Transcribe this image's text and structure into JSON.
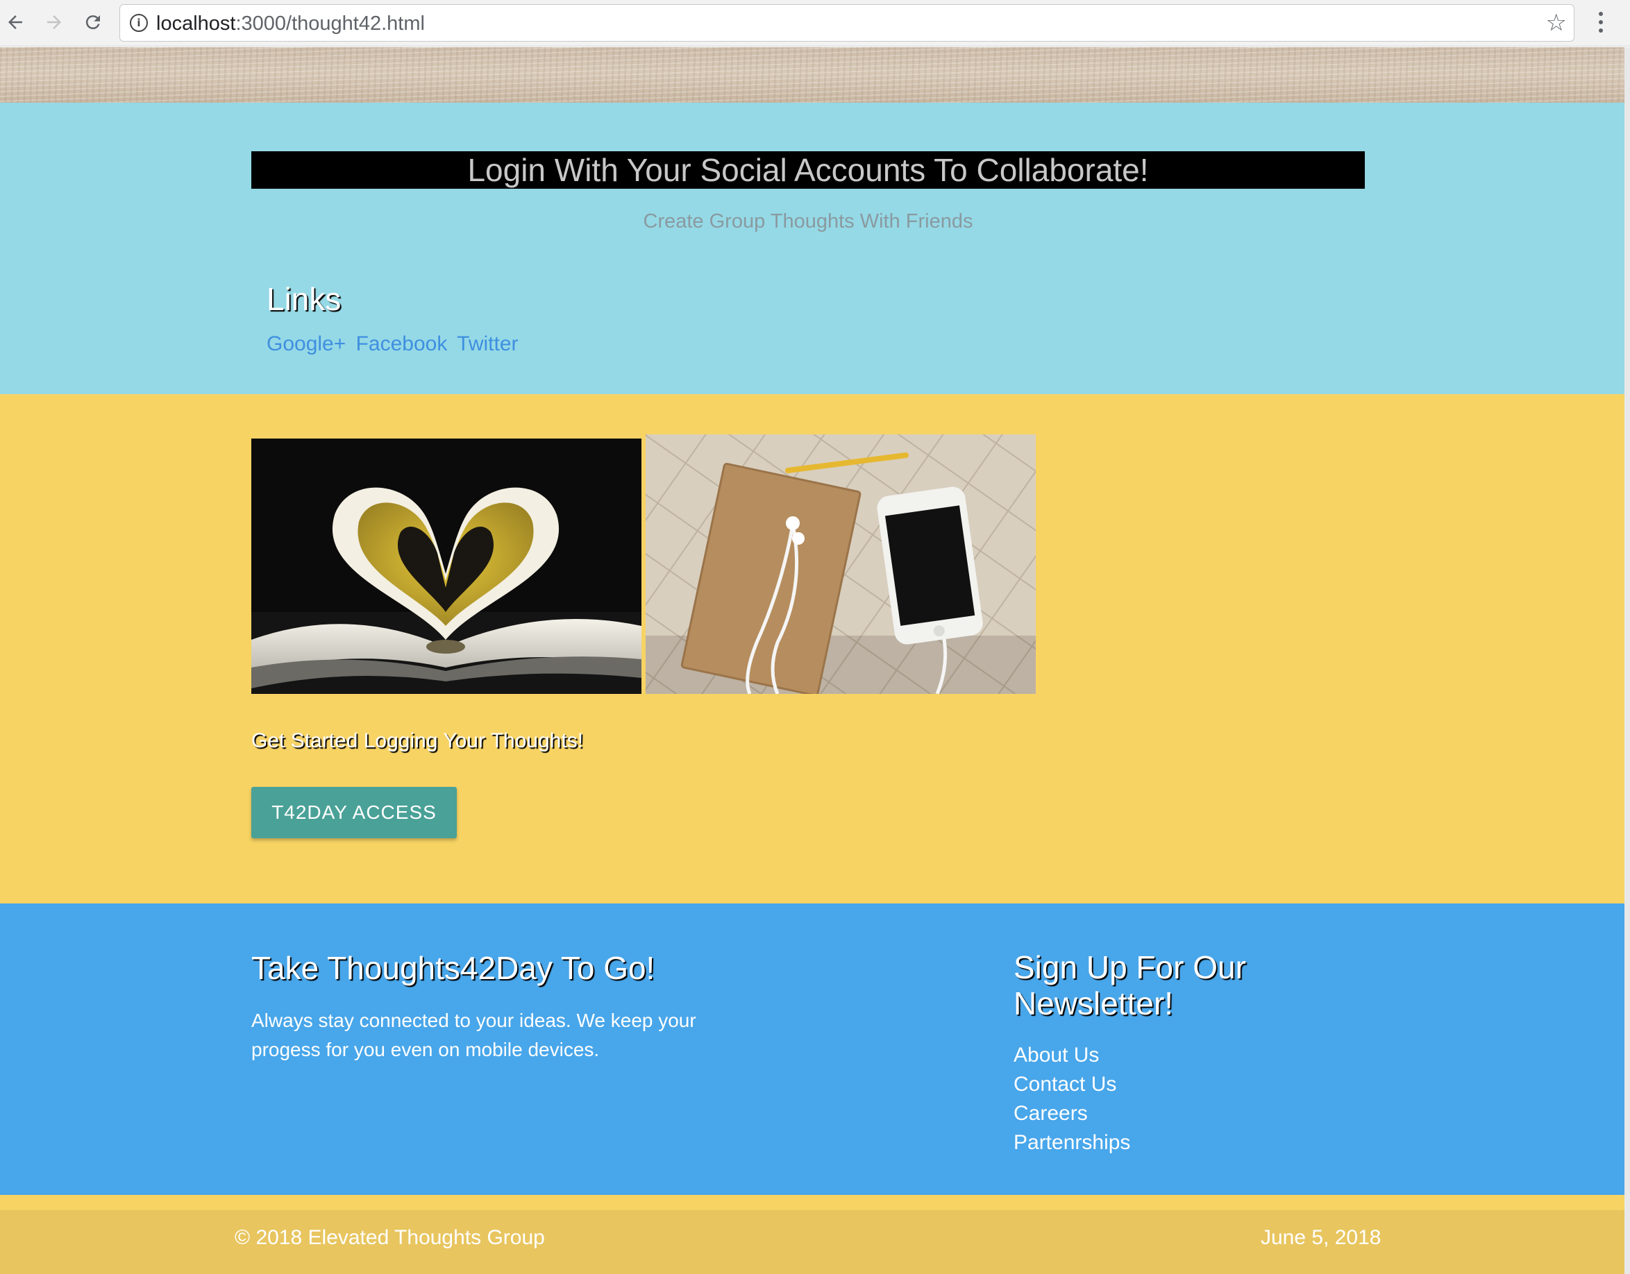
{
  "browser": {
    "url_host": "localhost",
    "url_rest": ":3000/thought42.html"
  },
  "hero": {
    "title": "Login With Your Social Accounts To Collaborate!",
    "subtitle": "Create Group Thoughts With Friends",
    "links_heading": "Links",
    "links": [
      "Google+",
      "Facebook",
      "Twitter"
    ]
  },
  "main": {
    "get_started": "Get Started Logging Your Thoughts!",
    "button_label": "T42DAY ACCESS"
  },
  "footer": {
    "mobile_title": "Take Thoughts42Day To Go!",
    "mobile_text": "Always stay connected to your ideas. We keep your progess for you even on mobile devices.",
    "newsletter_title": "Sign Up For Our Newsletter!",
    "links": [
      "About Us",
      "Contact Us",
      "Careers",
      "Partenrships"
    ],
    "copyright": "© 2018 Elevated Thoughts Group",
    "date": "June 5, 2018"
  },
  "colors": {
    "hero_bg": "#95d9e6",
    "content_bg": "#f7d364",
    "footer_bg": "#48a6ea",
    "button_bg": "#4aa197",
    "bottom_bar_bg": "#e8c55f"
  }
}
